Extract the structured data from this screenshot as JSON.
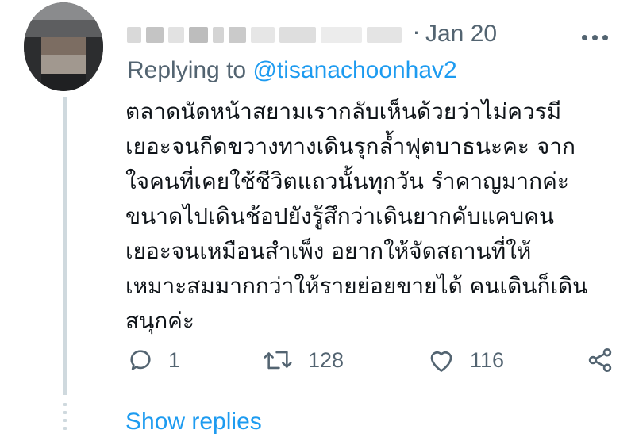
{
  "tweet": {
    "separator": "·",
    "date": "Jan 20",
    "replying_prefix": "Replying to ",
    "replying_handle": "@tisanachoonhav2",
    "body_lines": [
      "ตลาดนัดหน้าสยามเรากลับเห็นด้วยว่าไม่ควรมี",
      "เยอะจนกีดขวางทางเดินรุกล้ำฟุตบาธนะคะ จาก",
      "ใจคนที่เคยใช้ชีวิตแถวนั้นทุกวัน รำคาญมากค่ะ",
      "ขนาดไปเดินช้อปยังรู้สึกว่าเดินยากคับแคบคน",
      "เยอะจนเหมือนสำเพ็ง อยากให้จัดสถานที่ให้",
      "เหมาะสมมากกว่าให้รายย่อยขายได้ คนเดินก็เดิน",
      "สนุกค่ะ"
    ],
    "actions": {
      "reply_count": "1",
      "retweet_count": "128",
      "like_count": "116"
    },
    "show_replies": "Show replies",
    "icons": {
      "more": "more-horizontal-icon",
      "reply": "reply-bubble-icon",
      "retweet": "retweet-icon",
      "like": "heart-icon",
      "share": "share-icon"
    },
    "colors": {
      "link": "#1d9bf0",
      "muted": "#536471",
      "text": "#0f1419",
      "thread_line": "#cfd9de"
    }
  }
}
